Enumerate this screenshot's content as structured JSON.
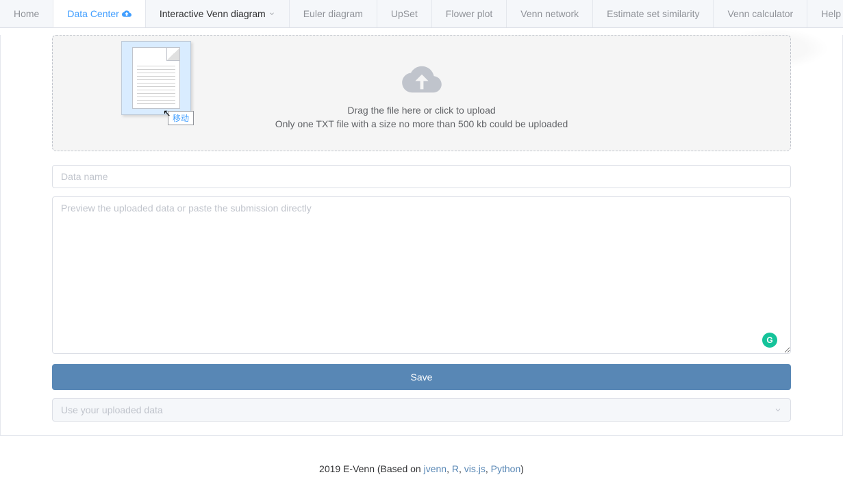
{
  "nav": {
    "home": "Home",
    "data_center": "Data Center",
    "interactive_venn": "Interactive Venn diagram",
    "euler": "Euler diagram",
    "upset": "UpSet",
    "flower": "Flower plot",
    "venn_network": "Venn network",
    "estimate": "Estimate set similarity",
    "calculator": "Venn calculator",
    "help": "Help"
  },
  "upload": {
    "drag_text": "Drag the file here or click to upload",
    "hint_text": "Only one TXT file with a size no more than 500 kb could be uploaded",
    "tooltip": "移动"
  },
  "form": {
    "data_name_placeholder": "Data name",
    "preview_placeholder": "Preview the uploaded data or paste the submission directly",
    "save_label": "Save",
    "select_placeholder": "Use your uploaded data"
  },
  "footer": {
    "prefix": "2019 E-Venn (Based on ",
    "link1": "jvenn",
    "sep1": ", ",
    "link2": "R",
    "sep2": ", ",
    "link3": "vis.js",
    "sep3": ", ",
    "link4": "Python",
    "suffix": ")"
  },
  "grammarly": "G"
}
